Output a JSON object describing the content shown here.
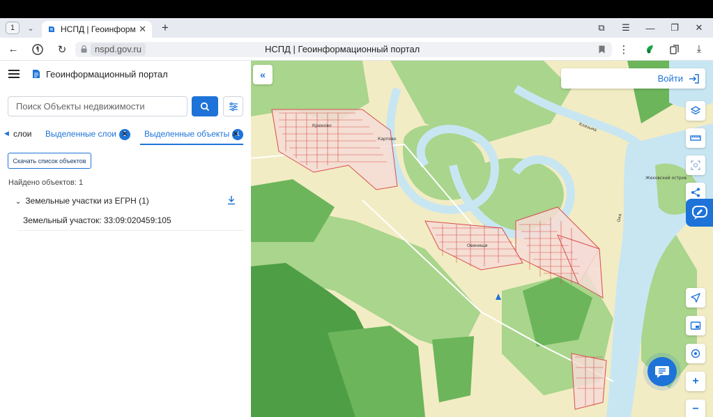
{
  "browser": {
    "tab_count": "1",
    "tab_title": "НСПД | Геоинформац",
    "url_domain": "nspd.gov.ru",
    "page_title": "НСПД | Геоинформационный портал"
  },
  "app": {
    "title": "Геоинформационный портал",
    "search_placeholder": "Поиск Объекты недвижимости",
    "tabs": [
      {
        "label": "слои"
      },
      {
        "label": "Выделенные слои",
        "badge": "2"
      },
      {
        "label": "Выделенные объекты",
        "badge": "1"
      }
    ],
    "download_button": "Скачать список объектов",
    "found_text": "Найдено объектов: 1",
    "group_label": "Земельные участки из ЕГРН (1)",
    "item_label": "Земельный участок: 33:09:020459:105"
  },
  "map": {
    "login_label": "Войти",
    "place_labels": [
      "Крюково",
      "Карпово",
      "Овинищи",
      "Клязьма",
      "Ока",
      "Жеховский остров"
    ],
    "colors": {
      "accent": "#1e73d8",
      "water": "#c8e6f2",
      "forest": "#6cb55a",
      "forest_dark": "#4e9e46",
      "meadow": "#a9d58c",
      "field": "#f2ecc4",
      "parcel_fill": "#f6dcd6",
      "parcel_stroke": "#d84c4c"
    }
  }
}
